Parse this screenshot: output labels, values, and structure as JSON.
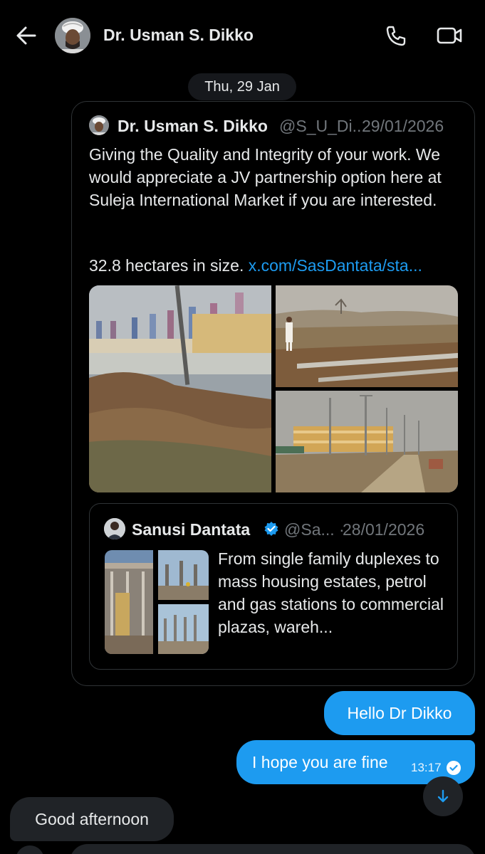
{
  "header": {
    "title": "Dr. Usman S. Dikko",
    "back_icon": "arrow-left-icon",
    "call_icon": "phone-icon",
    "video_icon": "video-camera-icon"
  },
  "date_separator": "Thu, 29 Jan",
  "shared_post": {
    "author_name": "Dr. Usman S. Dikko",
    "author_handle": "@S_U_Di...",
    "date": "29/01/2026",
    "text": "Giving the Quality and Integrity of your work. We would appreciate a JV partnership option here at Suleja International Market if you are interested.",
    "text_line2": "32.8 hectares in size. ",
    "link": "x.com/SasDantata/sta...",
    "quoted_post": {
      "author_name": "Sanusi Dantata",
      "author_handle": "@Sa...",
      "separator": "·",
      "date": "28/01/2026",
      "verified_icon": "verified-badge-icon",
      "text": "From single family duplexes to mass housing estates, petrol and gas stations to commercial plazas, wareh..."
    }
  },
  "messages": [
    {
      "direction": "out",
      "text": "Hello Dr Dikko"
    },
    {
      "direction": "out",
      "text": "I hope you are fine",
      "time": "13:17",
      "status_icon": "check-circle-icon"
    },
    {
      "direction": "in",
      "text": "Good afternoon"
    }
  ],
  "scroll_button_icon": "arrow-down-icon",
  "colors": {
    "background": "#000000",
    "outgoing_bubble": "#1d9bf0",
    "incoming_bubble": "#202327",
    "link": "#1d9bf0",
    "muted_text": "#71767b"
  }
}
